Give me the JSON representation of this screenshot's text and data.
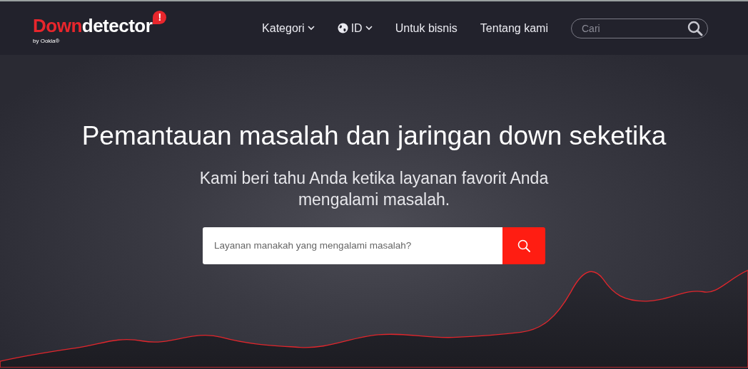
{
  "logo": {
    "parts": [
      {
        "text": "Down",
        "color": "#e8262c"
      },
      {
        "text": "detector",
        "color": "#ffffff"
      }
    ],
    "badge": "!",
    "tagline": "by Ookla®"
  },
  "nav": [
    {
      "kind": "dropdown",
      "label": "Kategori"
    },
    {
      "kind": "globe-dropdown",
      "label": "ID"
    },
    {
      "kind": "link",
      "label": "Untuk bisnis"
    },
    {
      "kind": "link",
      "label": "Tentang kami"
    }
  ],
  "nav_search": {
    "placeholder": "Cari"
  },
  "hero": {
    "title": "Pemantauan masalah dan jaringan down seketika",
    "subtitle": "Kami beri tahu Anda ketika layanan favorit Anda mengalami masalah.",
    "search": {
      "placeholder": "Layanan manakah yang mengalami masalah?"
    }
  }
}
